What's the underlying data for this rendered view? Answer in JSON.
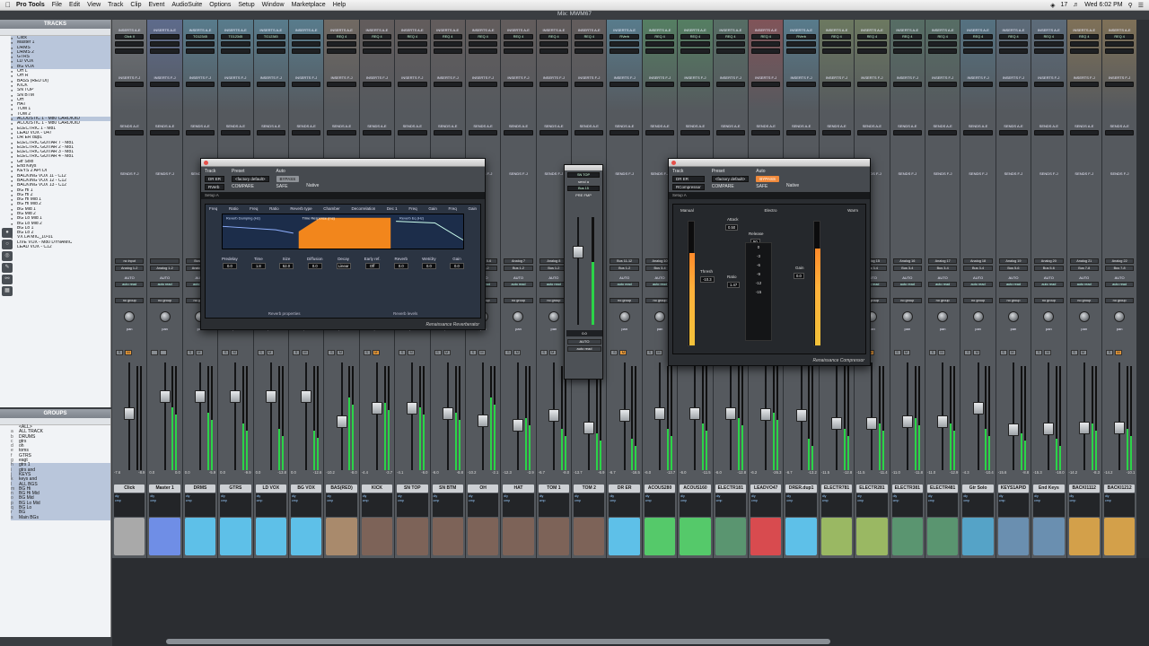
{
  "menubar": {
    "app": "Pro Tools",
    "items": [
      "File",
      "Edit",
      "View",
      "Track",
      "Clip",
      "Event",
      "AudioSuite",
      "Options",
      "Setup",
      "Window",
      "Marketplace",
      "Help"
    ],
    "status": [
      "17",
      "Wed 6:02 PM"
    ]
  },
  "window_title": "Mix: MWM67",
  "tracks_panel": {
    "title": "TRACKS",
    "items": [
      "Click",
      "Master 1",
      "DRMS",
      "DRMS 2",
      "GTRS",
      "LD VOX",
      "BG VOX",
      "OH L",
      "OH R",
      "BASS (RED DI)",
      "KICK",
      "SN TOP",
      "SN BTM",
      "OH",
      "HAT",
      "TOM 1",
      "TOM 2",
      "ACOUSTIC 1 - M80 CARDIOID",
      "ACOUSTIC 1 - M80 CARDIOID",
      "ELECTRIC 1 - M81",
      "LEAD VOX - U47",
      "DR ER dup1",
      "ELECTRIC GUITAR 7 - M81",
      "ELECTRIC GUITAR 2 - M81",
      "ELECTRIC GUITAR 3 - M81",
      "ELECTRIC GUITAR 4 - M81",
      "Gtr Solo",
      "End Keys",
      "KEYS 2 API DI",
      "BACKING VOX 11 - C12",
      "BACKING VOX 12 - C12",
      "BACKING VOX 13 - C12",
      "BG Hi 1",
      "BG Hi 2",
      "BG Hi Mid 1",
      "BG Hi Mid 2",
      "BG Mid 1",
      "BG Mid 2",
      "BG Lo Mid 1",
      "BG Lo Mid 2",
      "BG Lo 1",
      "BG Lo 2",
      "VX LA MIC_10-01",
      "LIVE VOX - M80 DYNAMIC",
      "LEAD VOX - C12"
    ]
  },
  "groups_panel": {
    "title": "GROUPS",
    "items": [
      {
        "id": "",
        "label": "<ALL>"
      },
      {
        "id": "a",
        "label": "ALL TRACK"
      },
      {
        "id": "b",
        "label": "DRUMS"
      },
      {
        "id": "c",
        "label": "gtrs"
      },
      {
        "id": "d",
        "label": "oh"
      },
      {
        "id": "e",
        "label": "toms"
      },
      {
        "id": "f",
        "label": "GTRS"
      },
      {
        "id": "g",
        "label": "eagt"
      },
      {
        "id": "h",
        "label": "gtrs 1"
      },
      {
        "id": "i",
        "label": "gtrs and"
      },
      {
        "id": "j",
        "label": "KEYS"
      },
      {
        "id": "k",
        "label": "keys and"
      },
      {
        "id": "l",
        "label": "ALL BGS"
      },
      {
        "id": "m",
        "label": "BG Hi"
      },
      {
        "id": "n",
        "label": "BG Hi Mid"
      },
      {
        "id": "o",
        "label": "BG Mid"
      },
      {
        "id": "p",
        "label": "BG Lo Mid"
      },
      {
        "id": "q",
        "label": "BG Lo"
      },
      {
        "id": "r",
        "label": "BG"
      },
      {
        "id": "s",
        "label": "Main BGs"
      }
    ]
  },
  "strips": [
    {
      "name": "Click",
      "color": "#a9a9a9",
      "insert": "Click II",
      "io": "no input",
      "out": "Analog 1-2",
      "vol": "-7.6",
      "peak": "-8.9",
      "fader": 0.55,
      "meter": 0.0,
      "btn": [
        "S",
        "M"
      ]
    },
    {
      "name": "Master 1",
      "color": "#6f8ee6",
      "insert": "",
      "io": "",
      "out": "Analog 1-2",
      "vol": "0.0",
      "peak": "0.0",
      "fader": 0.72,
      "meter": 0.6,
      "btn": [],
      "master": true
    },
    {
      "name": "DRMS",
      "color": "#5ec0e8",
      "insert": "TG12345",
      "io": "Bus 1-2",
      "out": "Analog 1-2",
      "vol": "0.0",
      "peak": "-5.9",
      "fader": 0.72,
      "meter": 0.55,
      "btn": [
        "S",
        "M"
      ]
    },
    {
      "name": "GTRS",
      "color": "#5ec0e8",
      "insert": "TG12345",
      "io": "Bus 5-6",
      "out": "Analog 1-2",
      "vol": "0.0",
      "peak": "-9.9",
      "fader": 0.72,
      "meter": 0.45,
      "btn": [
        "S",
        "M"
      ]
    },
    {
      "name": "LD VOX",
      "color": "#5ec0e8",
      "insert": "TG12345",
      "io": "Bus 7-8",
      "out": "Analog 1-2",
      "vol": "0.0",
      "peak": "-13.8",
      "fader": 0.72,
      "meter": 0.4,
      "btn": [
        "S",
        "M"
      ]
    },
    {
      "name": "BG VOX",
      "color": "#5ec0e8",
      "insert": "",
      "io": "Bus 9-10",
      "out": "Analog 1-2",
      "vol": "0.0",
      "peak": "-12.6",
      "fader": 0.72,
      "meter": 0.38,
      "btn": [
        "S",
        "M"
      ]
    },
    {
      "name": "BAS(RED)",
      "color": "#a98a6c",
      "insert": "REQ 4",
      "io": "Analog 1",
      "out": "Bus 1-2",
      "vol": "-10.2",
      "peak": "-8.0",
      "fader": 0.46,
      "meter": 0.7,
      "btn": [
        "S",
        "M"
      ]
    },
    {
      "name": "KICK",
      "color": "#7d6358",
      "insert": "REQ 4",
      "io": "Analog 2",
      "out": "Bus 1-2",
      "vol": "-4.4",
      "peak": "-3.7",
      "fader": 0.6,
      "meter": 0.65,
      "btn": [
        "S",
        "M"
      ]
    },
    {
      "name": "SN TOP",
      "color": "#7d6358",
      "insert": "REQ 4",
      "io": "Analog 3",
      "out": "Bus 1-2",
      "vol": "-4.1",
      "peak": "-6.0",
      "fader": 0.6,
      "meter": 0.6,
      "btn": [
        "S",
        "M"
      ]
    },
    {
      "name": "SN BTM",
      "color": "#7d6358",
      "insert": "REQ 4",
      "io": "Analog 4",
      "out": "Bus 1-2",
      "vol": "-6.0",
      "peak": "-8.8",
      "fader": 0.55,
      "meter": 0.55,
      "btn": [
        "S",
        "M"
      ]
    },
    {
      "name": "OH",
      "color": "#7d6358",
      "insert": "REQ 4",
      "io": "Analog 5-6",
      "out": "Bus 1-2",
      "vol": "-10.2",
      "peak": "-2.1",
      "fader": 0.47,
      "meter": 0.7,
      "btn": [
        "S",
        "M"
      ]
    },
    {
      "name": "HAT",
      "color": "#7d6358",
      "insert": "REQ 4",
      "io": "Analog 7",
      "out": "Bus 1-2",
      "vol": "-12.3",
      "peak": "-3.9",
      "fader": 0.43,
      "meter": 0.5,
      "btn": [
        "S",
        "M"
      ]
    },
    {
      "name": "TOM 1",
      "color": "#7d6358",
      "insert": "REQ 4",
      "io": "Analog 8",
      "out": "Bus 1-2",
      "vol": "-6.7",
      "peak": "-8.0",
      "fader": 0.53,
      "meter": 0.4,
      "btn": [
        "S",
        "M"
      ]
    },
    {
      "name": "TOM 2",
      "color": "#7d6358",
      "insert": "REQ 4",
      "io": "Analog 9",
      "out": "Bus 1-2",
      "vol": "-13.7",
      "peak": "-6.9",
      "fader": 0.4,
      "meter": 0.35,
      "btn": [
        "S",
        "M"
      ]
    },
    {
      "name": "DR ER",
      "color": "#5ec0e8",
      "insert": "RVerb",
      "io": "Bus 11-12",
      "out": "Bus 1-2",
      "vol": "-6.7",
      "peak": "-16.5",
      "fader": 0.53,
      "meter": 0.3,
      "btn": [
        "S",
        "M"
      ]
    },
    {
      "name": "ACOUS280",
      "color": "#55c96a",
      "insert": "REQ 4",
      "io": "Analog 10",
      "out": "Bus 3-4",
      "vol": "-6.0",
      "peak": "-13.7",
      "fader": 0.55,
      "meter": 0.4,
      "btn": [
        "S",
        "M"
      ]
    },
    {
      "name": "ACOUS160",
      "color": "#55c96a",
      "insert": "REQ 4",
      "io": "Analog 11",
      "out": "Bus 3-4",
      "vol": "-6.0",
      "peak": "-11.5",
      "fader": 0.55,
      "meter": 0.45,
      "btn": [
        "S",
        "M"
      ]
    },
    {
      "name": "ELECTR181",
      "color": "#5a9570",
      "insert": "REQ 4",
      "io": "Analog 12",
      "out": "Bus 3-4",
      "vol": "-6.0",
      "peak": "-12.8",
      "fader": 0.55,
      "meter": 0.5,
      "btn": [
        "S",
        "M"
      ]
    },
    {
      "name": "LEADVO47",
      "color": "#d84b4f",
      "insert": "REQ 4",
      "io": "Analog 13",
      "out": "Bus 7-8",
      "vol": "-6.2",
      "peak": "-26.3",
      "fader": 0.54,
      "meter": 0.55,
      "btn": [
        "S",
        "M"
      ]
    },
    {
      "name": "DRER.dup1",
      "color": "#5ec0e8",
      "insert": "RVerb",
      "io": "Bus 11-12",
      "out": "Bus 1-2",
      "vol": "-6.7",
      "peak": "-13.2",
      "fader": 0.53,
      "meter": 0.3,
      "btn": [
        "S",
        "M"
      ]
    },
    {
      "name": "ELECTR781",
      "color": "#9ab863",
      "insert": "REQ 4",
      "io": "Analog 14",
      "out": "Bus 3-4",
      "vol": "-11.5",
      "peak": "-12.8",
      "fader": 0.45,
      "meter": 0.4,
      "btn": [
        "S",
        "M"
      ]
    },
    {
      "name": "ELECTR281",
      "color": "#9ab863",
      "insert": "REQ 4",
      "io": "Analog 15",
      "out": "Bus 3-4",
      "vol": "-11.5",
      "peak": "-11.4",
      "fader": 0.45,
      "meter": 0.45,
      "btn": [
        "S",
        "M"
      ]
    },
    {
      "name": "ELECTR381",
      "color": "#5a9570",
      "insert": "REQ 4",
      "io": "Analog 16",
      "out": "Bus 3-4",
      "vol": "-11.0",
      "peak": "-11.8",
      "fader": 0.46,
      "meter": 0.5,
      "btn": [
        "S",
        "M"
      ]
    },
    {
      "name": "ELECTR481",
      "color": "#5a9570",
      "insert": "REQ 4",
      "io": "Analog 17",
      "out": "Bus 3-4",
      "vol": "-11.0",
      "peak": "-12.9",
      "fader": 0.46,
      "meter": 0.45,
      "btn": [
        "S",
        "M"
      ]
    },
    {
      "name": "Gtr Solo",
      "color": "#55a3c7",
      "insert": "REQ 4",
      "io": "Analog 18",
      "out": "Bus 3-4",
      "vol": "-4.3",
      "peak": "-10.4",
      "fader": 0.6,
      "meter": 0.4,
      "btn": [
        "S",
        "M"
      ]
    },
    {
      "name": "KEYS1APID",
      "color": "#6a8fb0",
      "insert": "REQ 4",
      "io": "Analog 19",
      "out": "Bus 5-6",
      "vol": "-15.6",
      "peak": "-8.8",
      "fader": 0.38,
      "meter": 0.35,
      "btn": [
        "S",
        "M"
      ]
    },
    {
      "name": "End Keys",
      "color": "#6a8fb0",
      "insert": "REQ 4",
      "io": "Analog 20",
      "out": "Bus 5-6",
      "vol": "-15.3",
      "peak": "-18.0",
      "fader": 0.39,
      "meter": 0.3,
      "btn": [
        "S",
        "M"
      ]
    },
    {
      "name": "BACKI1112",
      "color": "#d3a04a",
      "insert": "REQ 4",
      "io": "Analog 21",
      "out": "Bus 7-8",
      "vol": "-14.2",
      "peak": "-8.3",
      "fader": 0.4,
      "meter": 0.45,
      "btn": [
        "S",
        "M"
      ]
    },
    {
      "name": "BACKI1212",
      "color": "#d3a04a",
      "insert": "REQ 4",
      "io": "Analog 22",
      "out": "Bus 7-8",
      "vol": "-14.2",
      "peak": "-10.1",
      "fader": 0.4,
      "meter": 0.4,
      "btn": [
        "S",
        "M"
      ]
    }
  ],
  "strip_labels": {
    "inserts": "INSERTS A-E",
    "inserts2": "INSERTS F-J",
    "sends": "SENDS A-E",
    "sends2": "SENDS F-J",
    "auto": "AUTO",
    "auto_mode": "auto read",
    "group": "no group",
    "pan": "pan",
    "dly": "dly",
    "cmp": "cmp"
  },
  "reverb": {
    "track_label": "Track",
    "preset_label": "Preset",
    "auto_label": "Auto",
    "track": "DR ER",
    "insert": "RVerb",
    "preset": "<factory default>",
    "compare": "COMPARE",
    "safe": "SAFE",
    "bypass": "BYPASS",
    "native": "Native",
    "bar": "Setup A",
    "top_labels": [
      "Freq",
      "Ratio",
      "Freq",
      "Ratio",
      "Reverb type",
      "Decorrelation",
      "Freq",
      "Gain",
      "Freq",
      "Gain"
    ],
    "type_value": "Chamber",
    "decor_value": "Dec 1",
    "graph_labels": [
      "Reverb Damping (Hz)",
      "Time Response (ms)",
      "Reverb Eq (Hz)"
    ],
    "knobs": [
      {
        "label": "Predelay",
        "value": "0.0"
      },
      {
        "label": "Time",
        "value": "1.8"
      },
      {
        "label": "Size",
        "value": "52.0"
      },
      {
        "label": "Diffusion",
        "value": "0.0"
      },
      {
        "label": "Decay",
        "value": "Linear"
      },
      {
        "label": "Early ref.",
        "value": "Off"
      },
      {
        "label": "Reverb",
        "value": "0.0"
      },
      {
        "label": "Wet/dry",
        "value": "0.0"
      },
      {
        "label": "Gain",
        "value": "0.0"
      }
    ],
    "sections": [
      "Reverb properties",
      "Reverb levels"
    ],
    "brand": "Renaissance Reverberator"
  },
  "compressor": {
    "track_label": "Track",
    "preset_label": "Preset",
    "auto_label": "Auto",
    "track": "DR ER",
    "insert": "RCompressor",
    "preset": "<factory default>",
    "compare": "COMPARE",
    "safe": "SAFE",
    "bypass": "BYPASS",
    "native": "Native",
    "bar": "Setup A",
    "top_labels": [
      "Manual",
      "Electro",
      "Warm"
    ],
    "attack": {
      "label": "Attack",
      "value": "0.50"
    },
    "release": {
      "label": "Release",
      "value": "50"
    },
    "thresh": {
      "label": "Thresh",
      "value": "-10.3"
    },
    "ratio": {
      "label": "Ratio",
      "value": "1.47"
    },
    "gain": {
      "label": "Gain",
      "value": "0.0"
    },
    "scale": [
      "0",
      "-3",
      "-6",
      "-9",
      "-12",
      "-15"
    ],
    "brand": "Renaissance Compressor"
  },
  "send_window": {
    "title": "SN TOP",
    "send": "send a",
    "bus": "Bus 15",
    "value": "0.0",
    "auto": "AUTO",
    "mode": "auto read",
    "labels": [
      "PRE",
      "FMP"
    ]
  },
  "colors": {
    "menubar": "#e8e8e8",
    "bypass_on": "#f08a3c",
    "meter": "#2bd448"
  }
}
